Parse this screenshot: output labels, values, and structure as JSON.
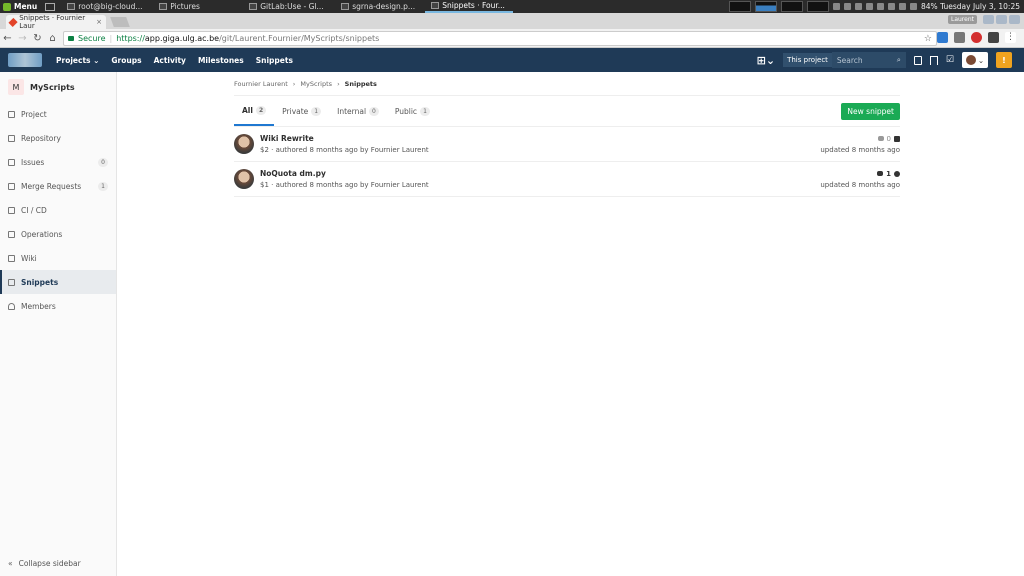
{
  "os": {
    "menu_label": "Menu",
    "tasks": [
      "root@big-cloud...",
      "Pictures",
      "GitLab:Use - Gl...",
      "sgrna-design.p...",
      "Snippets · Four..."
    ],
    "status_text": "84% Tuesday July  3, 10:25",
    "user_badge": "Laurent"
  },
  "browser": {
    "tab_title": "Snippets · Fournier Laur",
    "tab_close": "×",
    "secure_label": "Secure",
    "url_proto": "https://",
    "url_host": "app.giga.ulg.ac.be",
    "url_path": "/git/Laurent.Fournier/MyScripts/snippets"
  },
  "header": {
    "nav": [
      "Projects ⌄",
      "Groups",
      "Activity",
      "Milestones",
      "Snippets"
    ],
    "scope_label": "This project",
    "search_placeholder": "Search"
  },
  "sidebar": {
    "project_initial": "M",
    "project_name": "MyScripts",
    "items": [
      {
        "label": "Project",
        "count": ""
      },
      {
        "label": "Repository",
        "count": ""
      },
      {
        "label": "Issues",
        "count": "0"
      },
      {
        "label": "Merge Requests",
        "count": "1"
      },
      {
        "label": "CI / CD",
        "count": ""
      },
      {
        "label": "Operations",
        "count": ""
      },
      {
        "label": "Wiki",
        "count": ""
      },
      {
        "label": "Snippets",
        "count": ""
      },
      {
        "label": "Members",
        "count": ""
      }
    ],
    "active_index": 7,
    "collapse_label": "Collapse sidebar"
  },
  "breadcrumb": [
    "Fournier Laurent",
    "MyScripts",
    "Snippets"
  ],
  "tabs": [
    {
      "label": "All",
      "count": "2"
    },
    {
      "label": "Private",
      "count": "1"
    },
    {
      "label": "Internal",
      "count": "0"
    },
    {
      "label": "Public",
      "count": "1"
    }
  ],
  "new_snippet_label": "New snippet",
  "snippets": [
    {
      "title": "Wiki Rewrite",
      "meta": "$2 · authored 8 months ago by Fournier Laurent",
      "comments": "0",
      "visibility": "lock-icon",
      "updated": "updated 8 months ago"
    },
    {
      "title": "NoQuota dm.py",
      "meta": "$1 · authored 8 months ago by Fournier Laurent",
      "comments": "1",
      "visibility": "globe-icon",
      "updated": "updated 8 months ago"
    }
  ]
}
